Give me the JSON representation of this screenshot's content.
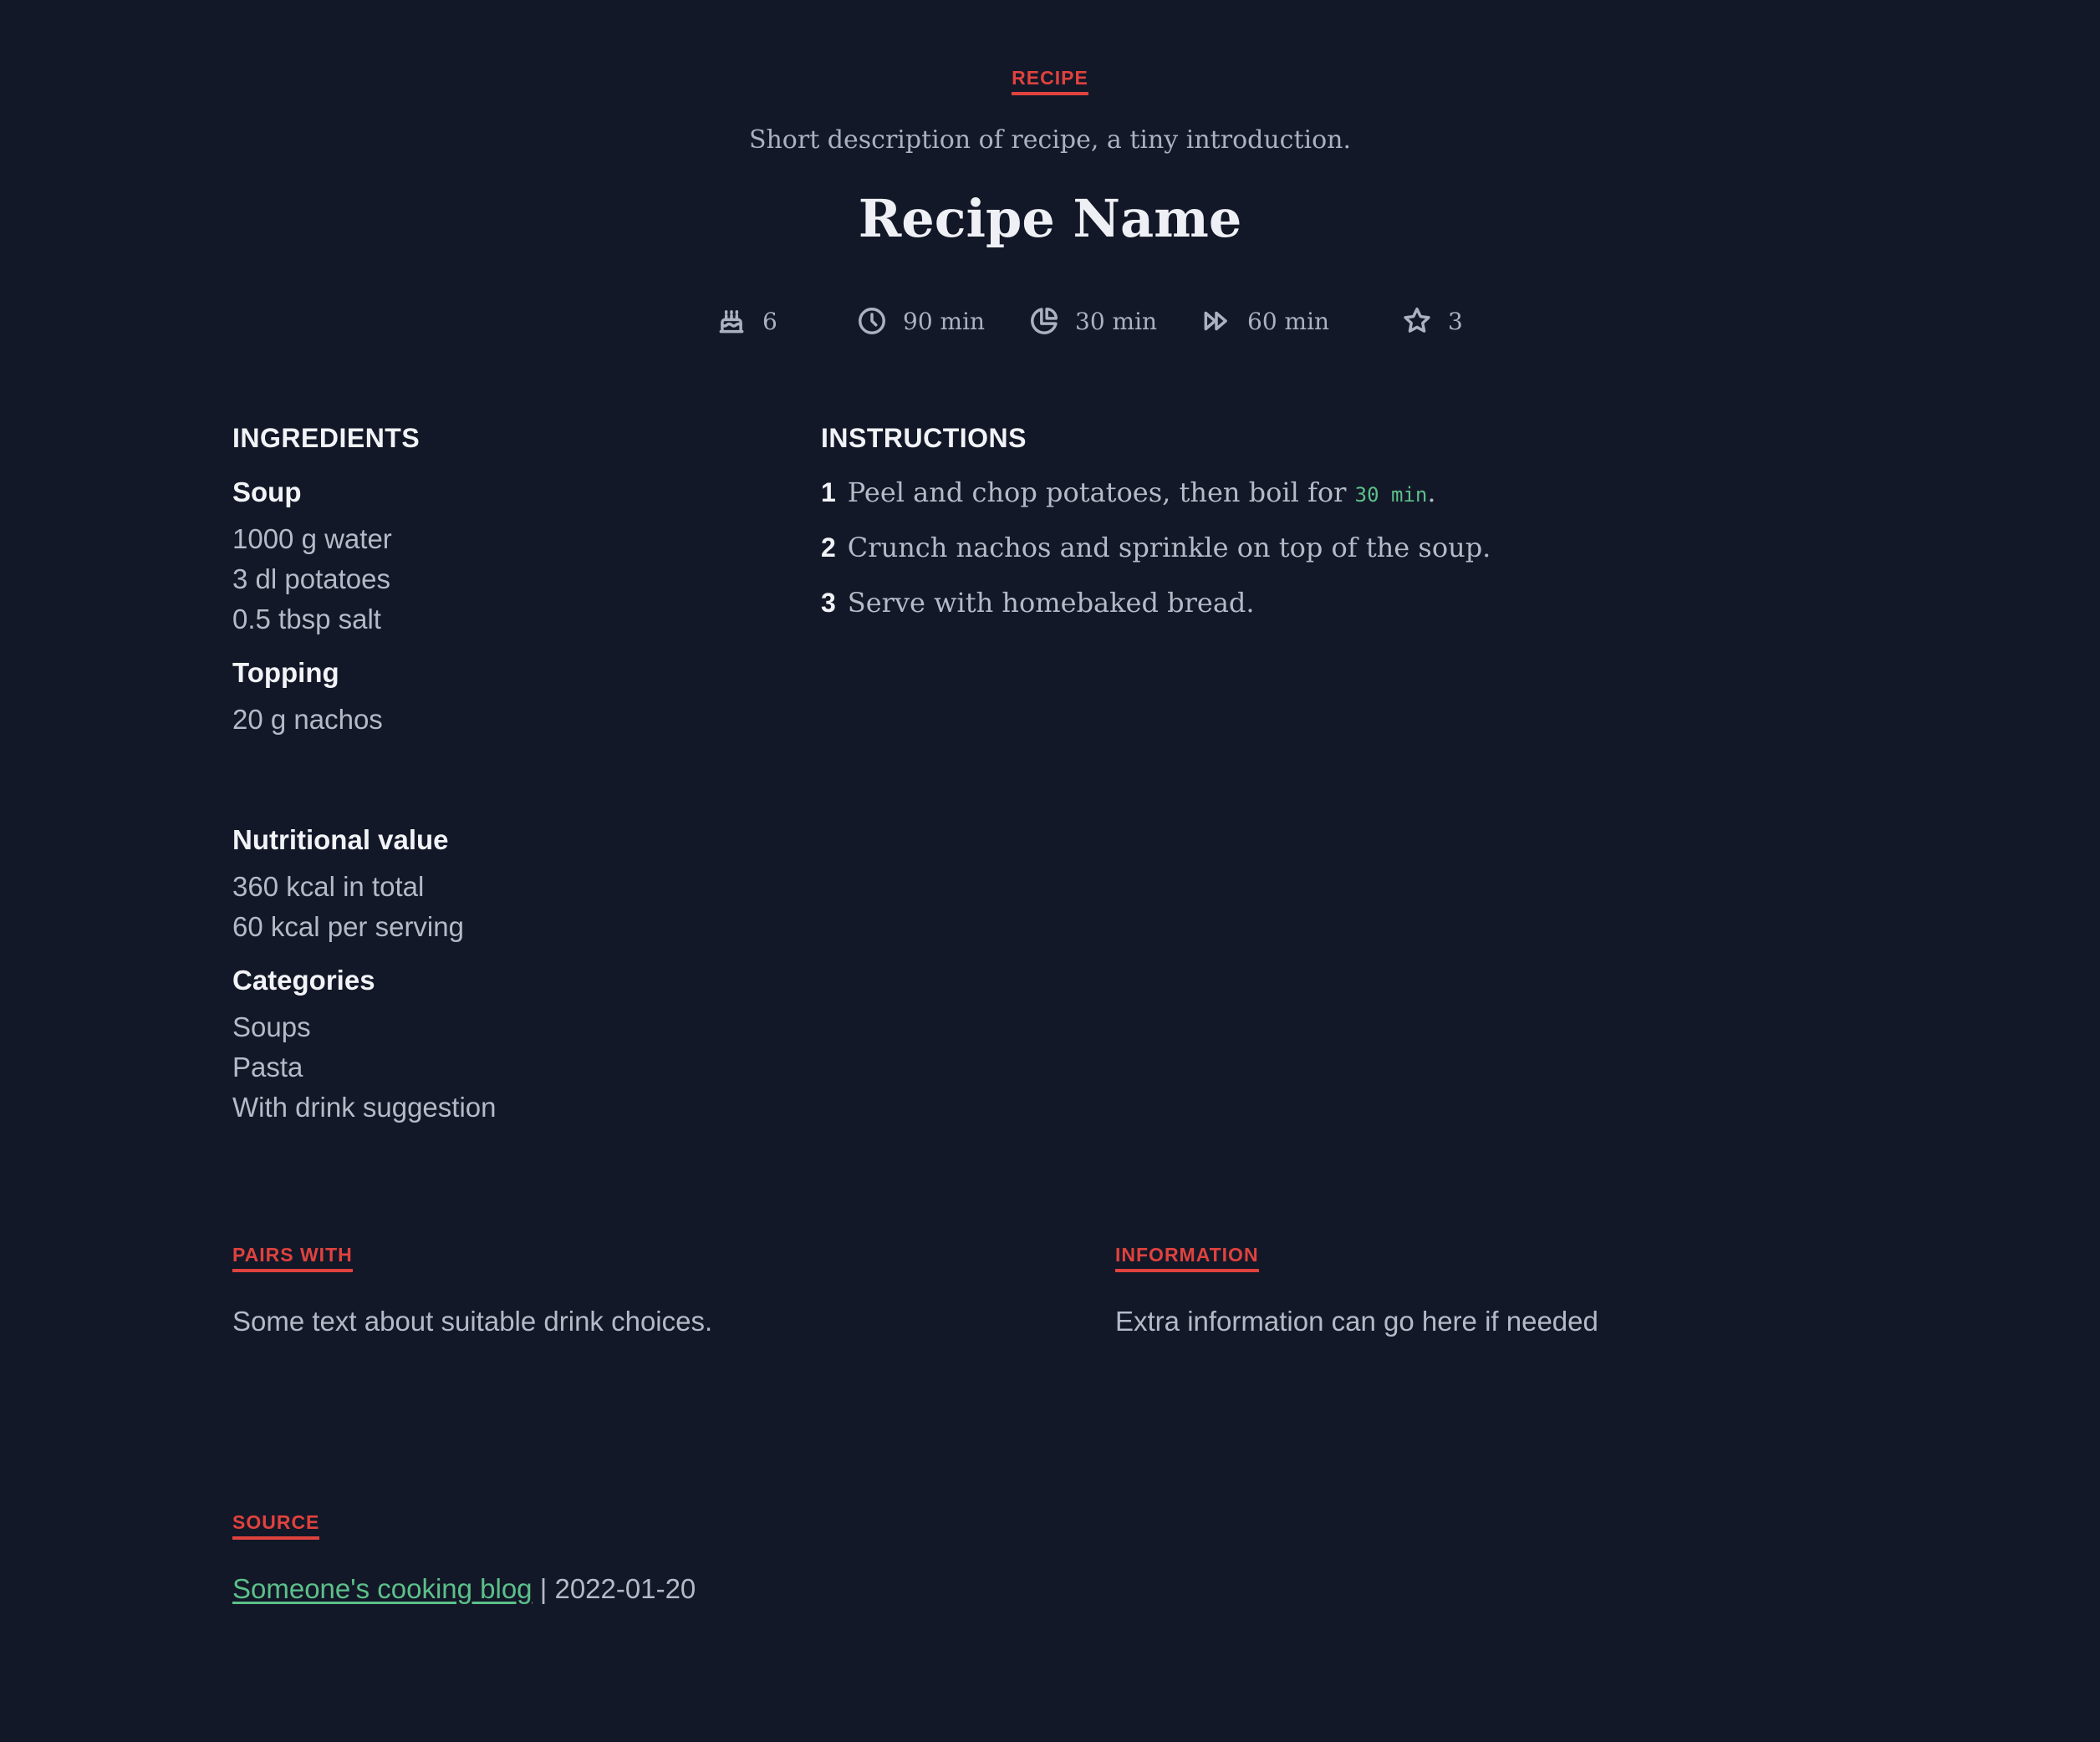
{
  "header": {
    "kicker": "RECIPE",
    "description": "Short description of recipe, a tiny introduction.",
    "title": "Recipe Name"
  },
  "meta": {
    "servings": "6",
    "total_time": "90 min",
    "prep_time": "30 min",
    "cook_time": "60 min",
    "rating": "3",
    "icons": [
      "cake-icon",
      "clock-icon",
      "pie-chart-icon",
      "fast-forward-icon",
      "star-icon"
    ]
  },
  "ingredients": {
    "heading": "INGREDIENTS",
    "groups": [
      {
        "name": "Soup",
        "items": [
          "1000 g water",
          "3 dl potatoes",
          "0.5 tbsp salt"
        ]
      },
      {
        "name": "Topping",
        "items": [
          "20 g nachos"
        ]
      }
    ]
  },
  "instructions": {
    "heading": "INSTRUCTIONS",
    "steps": [
      {
        "num": "1",
        "text": "Peel and chop potatoes, then boil for ",
        "code": "30 min",
        "after": "."
      },
      {
        "num": "2",
        "text": "Crunch nachos and sprinkle on top of the soup."
      },
      {
        "num": "3",
        "text": "Serve with homebaked bread."
      }
    ]
  },
  "nutrition": {
    "heading": "Nutritional value",
    "items": [
      "360 kcal in total",
      "60 kcal per serving"
    ]
  },
  "categories": {
    "heading": "Categories",
    "items": [
      "Soups",
      "Pasta",
      "With drink suggestion"
    ]
  },
  "pairs_with": {
    "label": "PAIRS WITH",
    "text": "Some text about suitable drink choices."
  },
  "information": {
    "label": "INFORMATION",
    "text": "Extra information can go here if needed"
  },
  "source": {
    "label": "SOURCE",
    "link_text": "Someone's cooking blog",
    "separator": " | ",
    "date": "2022-01-20"
  },
  "colors": {
    "background": "#131828",
    "accent_red": "#e0423e",
    "link_green": "#5cc08a",
    "heading": "#f2f3f7",
    "text": "#b4bac7"
  }
}
